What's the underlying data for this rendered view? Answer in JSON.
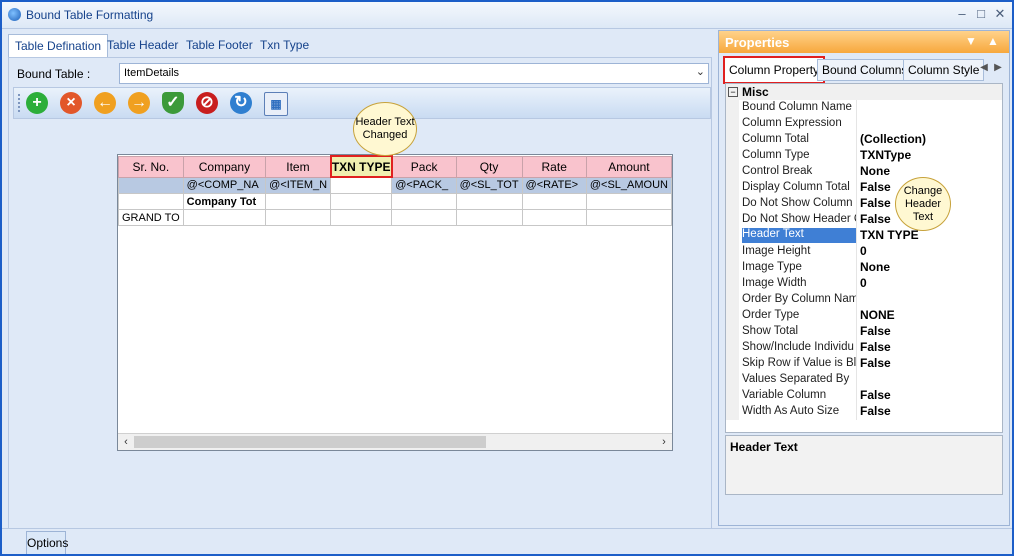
{
  "window": {
    "title": "Bound Table Formatting"
  },
  "left": {
    "tabs": [
      "Table Defination",
      "Table Header",
      "Table Footer",
      "Txn Type"
    ],
    "bound_table_label": "Bound Table :",
    "bound_table_value": "ItemDetails",
    "toolbar_icons": [
      "add-icon",
      "delete-icon",
      "back-icon",
      "forward-icon",
      "shield-check-icon",
      "stop-icon",
      "refresh-icon",
      "grid-layout-icon"
    ],
    "grid": {
      "headers": [
        "Sr. No.",
        "Company",
        "Item",
        "TXN TYPE",
        "Pack",
        "Qty",
        "Rate",
        "Amount"
      ],
      "rows": [
        [
          "",
          "@<COMP_NA",
          "@<ITEM_N",
          "",
          "@<PACK_",
          "@<SL_TOT",
          "@<RATE>",
          "@<SL_AMOUN"
        ],
        [
          "",
          "Company Tot",
          "",
          "",
          "",
          "",
          "",
          ""
        ],
        [
          "GRAND TO",
          "",
          "",
          "",
          "",
          "",
          "",
          ""
        ]
      ]
    },
    "callout": "Header Text Changed",
    "options_button": "Options"
  },
  "right": {
    "title": "Properties",
    "tabs": [
      "Column Property",
      "Bound Columns",
      "Column Style"
    ],
    "category": "Misc",
    "props": [
      {
        "name": "Bound Column Name",
        "value": ""
      },
      {
        "name": "Column Expression",
        "value": ""
      },
      {
        "name": "Column Total",
        "value": "(Collection)"
      },
      {
        "name": "Column Type",
        "value": "TXNType"
      },
      {
        "name": "Control Break",
        "value": "None"
      },
      {
        "name": "Display Column Total",
        "value": "False"
      },
      {
        "name": "Do Not Show Column",
        "value": "False"
      },
      {
        "name": "Do Not Show Header C",
        "value": "False"
      },
      {
        "name": "Header Text",
        "value": "TXN TYPE"
      },
      {
        "name": "Image Height",
        "value": "0"
      },
      {
        "name": "Image Type",
        "value": "None"
      },
      {
        "name": "Image Width",
        "value": "0"
      },
      {
        "name": "Order By Column Nam",
        "value": ""
      },
      {
        "name": "Order Type",
        "value": "NONE"
      },
      {
        "name": "Show Total",
        "value": "False"
      },
      {
        "name": "Show/Include Individu",
        "value": "False"
      },
      {
        "name": "Skip Row if Value is Bl",
        "value": "False"
      },
      {
        "name": "Values Separated By",
        "value": ""
      },
      {
        "name": "Variable Column",
        "value": "False"
      },
      {
        "name": "Width As Auto Size",
        "value": "False"
      }
    ],
    "callout": "Change Header Text",
    "description_title": "Header Text"
  }
}
